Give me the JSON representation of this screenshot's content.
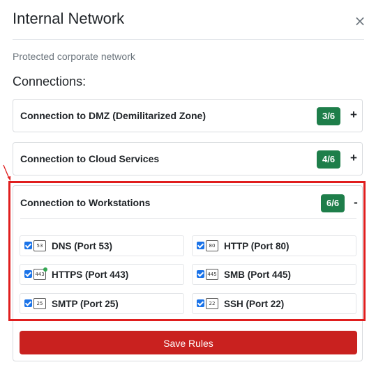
{
  "modal": {
    "title": "Internal Network",
    "close_glyph": "×",
    "subtitle": "Protected corporate network",
    "section_label": "Connections:"
  },
  "connections": [
    {
      "name": "Connection to DMZ (Demilitarized Zone)",
      "badge": "3/6",
      "toggle": "+",
      "expanded": false
    },
    {
      "name": "Connection to Cloud Services",
      "badge": "4/6",
      "toggle": "+",
      "expanded": false
    },
    {
      "name": "Connection to Workstations",
      "badge": "6/6",
      "toggle": "-",
      "expanded": true,
      "rules": [
        {
          "label": "DNS (Port 53)",
          "port": "53",
          "checked": true,
          "icon": "port-icon"
        },
        {
          "label": "HTTP (Port 80)",
          "port": "80",
          "checked": true,
          "icon": "port-icon"
        },
        {
          "label": "HTTPS (Port 443)",
          "port": "443",
          "checked": true,
          "icon": "secure-port-icon"
        },
        {
          "label": "SMB (Port 445)",
          "port": "445",
          "checked": true,
          "icon": "port-icon"
        },
        {
          "label": "SMTP (Port 25)",
          "port": "25",
          "checked": true,
          "icon": "port-icon"
        },
        {
          "label": "SSH (Port 22)",
          "port": "22",
          "checked": true,
          "icon": "port-icon"
        }
      ]
    }
  ],
  "save_button": {
    "label": "Save Rules"
  },
  "colors": {
    "badge": "#1e7e4a",
    "save_button": "#c9211f",
    "highlight": "#e01e1e",
    "checkbox": "#1a73e8"
  }
}
